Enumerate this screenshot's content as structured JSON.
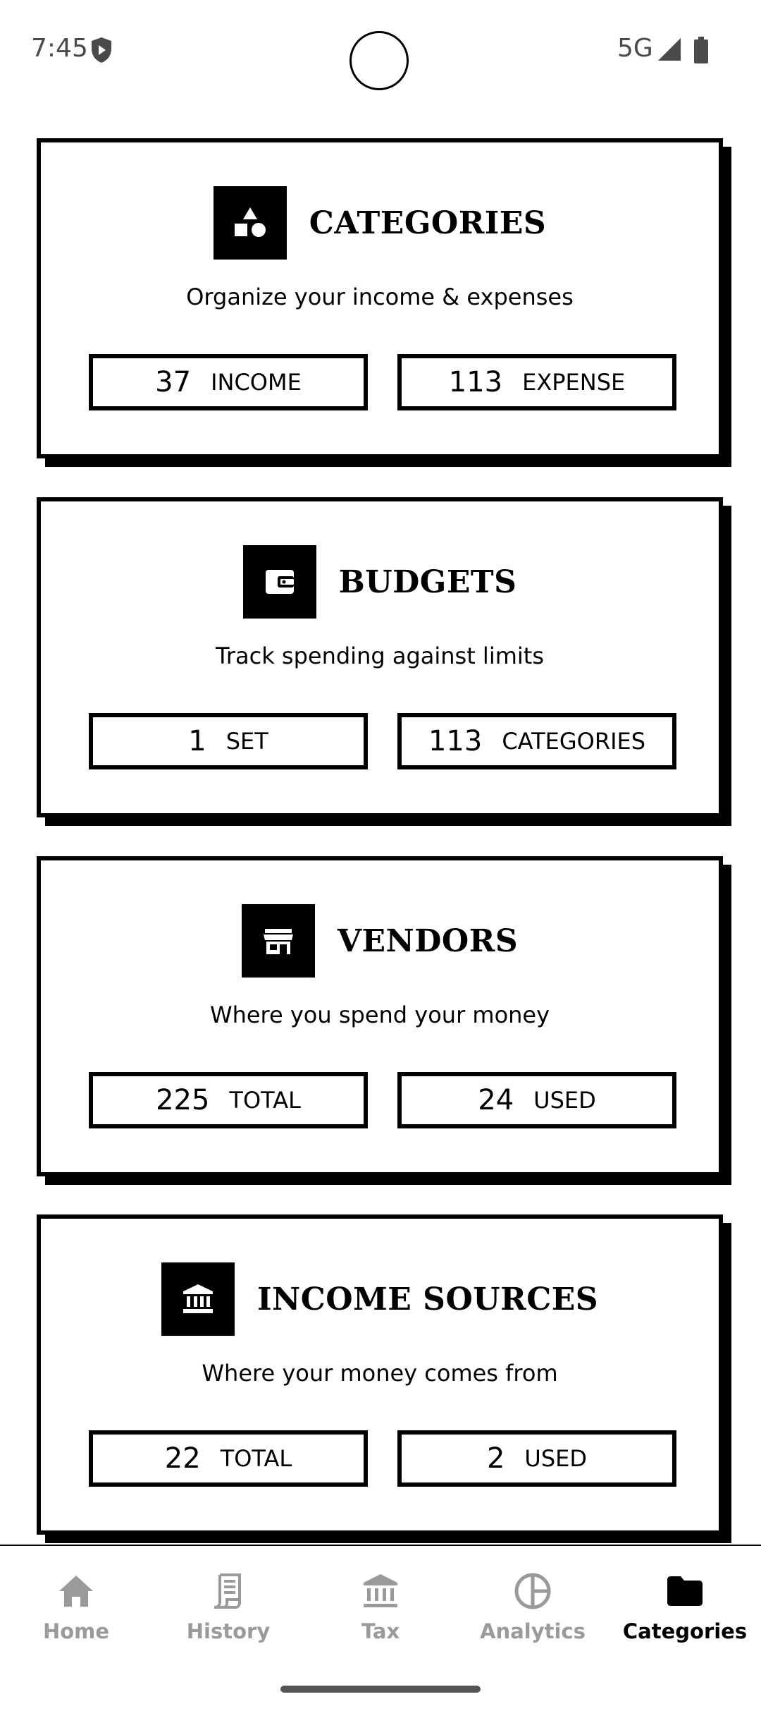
{
  "status_bar": {
    "time": "7:45",
    "network": "5G",
    "icons": [
      "shield-icon",
      "signal-icon",
      "battery-icon"
    ]
  },
  "cards": [
    {
      "title": "CATEGORIES",
      "icon": "shapes-icon",
      "subtitle": "Organize your income & expenses",
      "stats": [
        {
          "value": "37",
          "label": "INCOME"
        },
        {
          "value": "113",
          "label": "EXPENSE"
        }
      ]
    },
    {
      "title": "BUDGETS",
      "icon": "wallet-icon",
      "subtitle": "Track spending against limits",
      "stats": [
        {
          "value": "1",
          "label": "SET"
        },
        {
          "value": "113",
          "label": "CATEGORIES"
        }
      ]
    },
    {
      "title": "VENDORS",
      "icon": "store-icon",
      "subtitle": "Where you spend your money",
      "stats": [
        {
          "value": "225",
          "label": "TOTAL"
        },
        {
          "value": "24",
          "label": "USED"
        }
      ]
    },
    {
      "title": "INCOME SOURCES",
      "icon": "bank-icon",
      "subtitle": "Where your money comes from",
      "stats": [
        {
          "value": "22",
          "label": "TOTAL"
        },
        {
          "value": "2",
          "label": "USED"
        }
      ]
    }
  ],
  "bottom_nav": {
    "items": [
      {
        "label": "Home",
        "icon": "home-icon",
        "active": false
      },
      {
        "label": "History",
        "icon": "receipt-icon",
        "active": false
      },
      {
        "label": "Tax",
        "icon": "bank-icon",
        "active": false
      },
      {
        "label": "Analytics",
        "icon": "pie-chart-icon",
        "active": false
      },
      {
        "label": "Categories",
        "icon": "folder-icon",
        "active": true
      }
    ],
    "active_color": "#000000",
    "inactive_color": "#9a9a9a"
  }
}
